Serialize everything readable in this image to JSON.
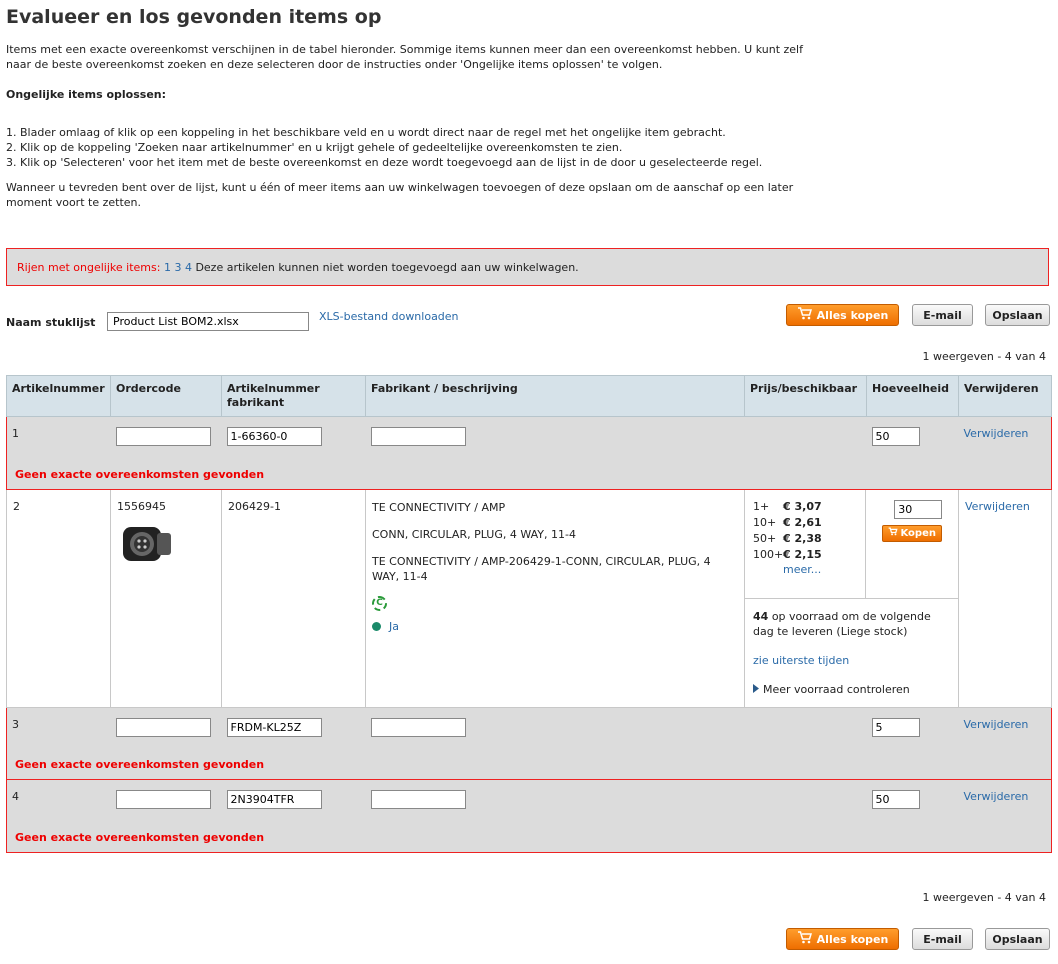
{
  "title": "Evalueer en los gevonden items op",
  "intro": "Items met een exacte overeenkomst verschijnen in de tabel hieronder. Sommige items kunnen meer dan een overeenkomst hebben. U kunt zelf naar de beste overeenkomst zoeken en deze selecteren door de instructies onder 'Ongelijke items oplossen' te volgen.",
  "resolve_heading": "Ongelijke items oplossen:",
  "steps": [
    "1.  Blader omlaag of klik op een koppeling in het beschikbare veld en u wordt direct naar de regel met het ongelijke item gebracht.",
    "2.  Klik op de koppeling 'Zoeken naar artikelnummer' en u krijgt gehele of gedeeltelijke overeenkomsten te zien.",
    "3.  Klik op 'Selecteren' voor het item met de beste overeenkomst en deze wordt toegevoegd aan de lijst in de door u geselecteerde regel."
  ],
  "outro": "Wanneer u tevreden bent over de lijst, kunt u één of meer items aan uw winkelwagen toevoegen of deze opslaan om de aanschaf op een later moment voort te zetten.",
  "alert": {
    "label": "Rijen met ongelijke items:",
    "links": [
      "1",
      "3",
      "4"
    ],
    "message": "Deze artikelen kunnen niet worden toegevoegd aan uw winkelwagen."
  },
  "bom": {
    "label": "Naam stuklijst",
    "name": "Product List BOM2.xlsx",
    "download": "XLS-bestand downloaden"
  },
  "buttons": {
    "buy_all": "Alles kopen",
    "email": "E-mail",
    "save": "Opslaan"
  },
  "count_text": "1 weergeven - 4 van 4",
  "columns": {
    "artnr": "Artikelnummer",
    "ordercode": "Ordercode",
    "mfr_pn_1": "Artikelnummer",
    "mfr_pn_2": "fabrikant",
    "mfr_desc": "Fabrikant / beschrijving",
    "price": "Prijs/beschikbaar",
    "qty": "Hoeveelheid",
    "remove": "Verwijderen"
  },
  "no_match": "Geen exacte overeenkomsten gevonden",
  "remove_link": "Verwijderen",
  "rows": [
    {
      "num": "1",
      "ordercode": "",
      "mfr_pn": "1-66360-0",
      "desc": "",
      "qty": "50"
    },
    {
      "num": "3",
      "ordercode": "",
      "mfr_pn": "FRDM-KL25Z",
      "desc": "",
      "qty": "5"
    },
    {
      "num": "4",
      "ordercode": "",
      "mfr_pn": "2N3904TFR",
      "desc": "",
      "qty": "50"
    }
  ],
  "matched": {
    "num": "2",
    "ordercode": "1556945",
    "mfr_pn": "206429-1",
    "manufacturer": "TE CONNECTIVITY / AMP",
    "short_desc": "CONN, CIRCULAR, PLUG, 4 WAY, 11-4",
    "long_desc": "TE CONNECTIVITY / AMP-206429-1-CONN, CIRCULAR, PLUG, 4 WAY, 11-4",
    "rohs_symbol": "C",
    "avail_label": "Ja",
    "prices": [
      {
        "q": "1+",
        "p": "€ 3,07"
      },
      {
        "q": "10+",
        "p": "€ 2,61"
      },
      {
        "q": "50+",
        "p": "€ 2,38"
      },
      {
        "q": "100+",
        "p": "€ 2,15"
      }
    ],
    "more": "meer...",
    "qty": "30",
    "buy": "Kopen",
    "stock_count": "44",
    "stock_text": "op voorraad om de volgende dag te leveren (Liege stock)",
    "cutoff_link": "zie uiterste tijden",
    "check_stock": "Meer voorraad controleren"
  },
  "colors": {
    "accent_orange": "#ee6e00",
    "link_blue": "#2a6aa8",
    "error_red": "#e00000",
    "header_bg": "#d6e2e9"
  }
}
